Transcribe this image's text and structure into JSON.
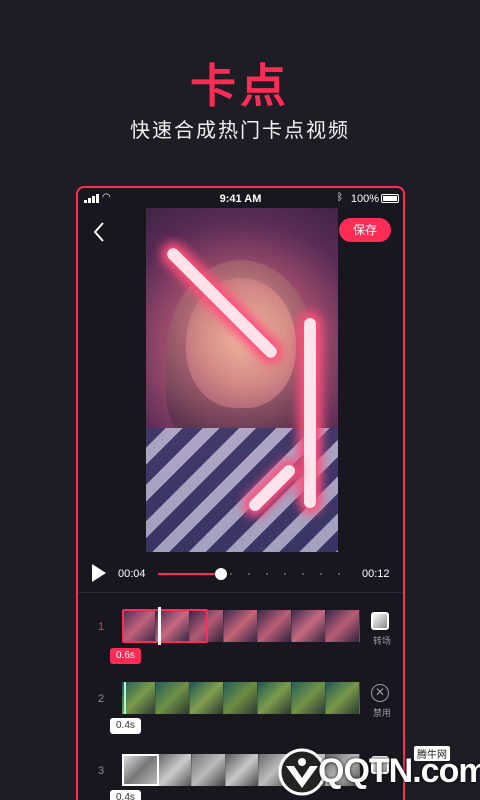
{
  "hero": {
    "title": "卡点",
    "subtitle": "快速合成热门卡点视频"
  },
  "status": {
    "time": "9:41 AM",
    "battery": "100%"
  },
  "editor": {
    "save_label": "保存",
    "current_time": "00:04",
    "total_time": "00:12",
    "progress": 0.33
  },
  "tracks": [
    {
      "index": "1",
      "duration": "0.6s",
      "action": "转场",
      "active": true
    },
    {
      "index": "2",
      "duration": "0.4s",
      "action": "禁用",
      "active": false
    },
    {
      "index": "3",
      "duration": "0.4s",
      "action": "",
      "active": false
    }
  ],
  "watermark": {
    "text": "QQTN.com",
    "cn": "腾牛网"
  },
  "colors": {
    "accent": "#ff2d55",
    "background": "#1e1d26"
  }
}
